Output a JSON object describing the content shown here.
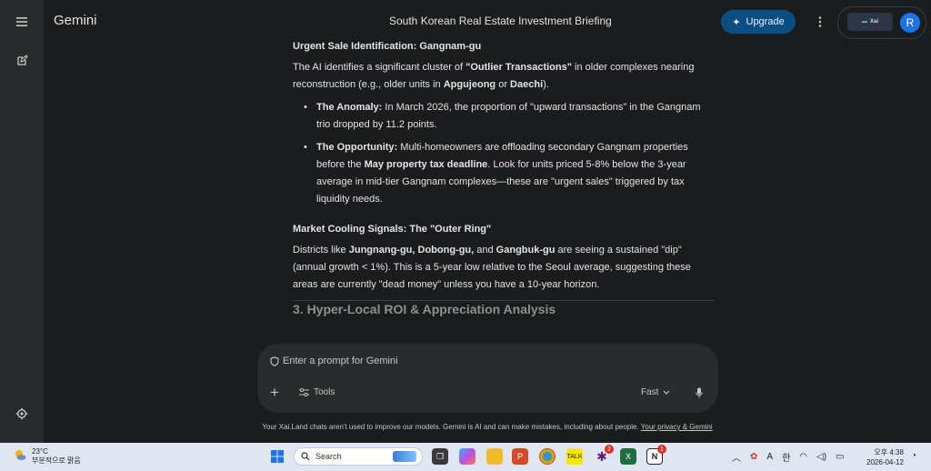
{
  "app": {
    "name": "Gemini"
  },
  "conversation": {
    "title": "South Korean Real Estate Investment Briefing"
  },
  "header": {
    "upgrade_label": "Upgrade",
    "account_initial": "R",
    "logo_text": "Xai"
  },
  "content": {
    "urgent_heading": "Urgent Sale Identification: Gangnam-gu",
    "urgent_intro": {
      "t1": "The AI identifies a significant cluster of ",
      "b1": "\"Outlier Transactions\"",
      "t2": " in older complexes nearing reconstruction (e.g., older units in ",
      "b2": "Apgujeong",
      "t3": " or ",
      "b3": "Daechi",
      "t4": ")."
    },
    "bullets": [
      {
        "label": "The Anomaly:",
        "text": " In March 2026, the proportion of \"upward transactions\" in the Gangnam trio dropped by 11.2 points."
      },
      {
        "label": "The Opportunity:",
        "t1": " Multi-homeowners are offloading secondary Gangnam properties before the ",
        "b1": "May property tax deadline",
        "t2": ". Look for units priced 5-8% below the 3-year average in mid-tier Gangnam complexes—these are \"urgent sales\" triggered by tax liquidity needs."
      }
    ],
    "cooling_heading": "Market Cooling Signals: The \"Outer Ring\"",
    "cooling": {
      "t1": "Districts like ",
      "b1": "Jungnang-gu, Dobong-gu,",
      "t2": " and ",
      "b2": "Gangbuk-gu",
      "t3": " are seeing a sustained \"dip\" (annual growth < 1%). This is a 5-year low relative to the Seoul average, suggesting these areas are currently \"dead money\" unless you have a 10-year horizon."
    },
    "section3_heading": "3. Hyper-Local ROI & Appreciation Analysis"
  },
  "prompt": {
    "placeholder": "Enter a prompt for Gemini",
    "tools_label": "Tools",
    "mode_label": "Fast"
  },
  "disclaimer": {
    "text": "Your Xai.Land chats aren't used to improve our models. Gemini is AI and can make mistakes, including about people. ",
    "link": "Your privacy & Gemini"
  },
  "taskbar": {
    "temperature": "23°C",
    "weather_desc": "부분적으로 맑음",
    "search_label": "Search",
    "ime_a": "A",
    "ime_han": "한",
    "time": "오후 4:38",
    "date": "2026-04-12",
    "badge_1": "2",
    "badge_2": "1"
  },
  "colors": {
    "accent": "#0b4f82",
    "avatar": "#1a73e8",
    "background": "#1b1c1d"
  }
}
